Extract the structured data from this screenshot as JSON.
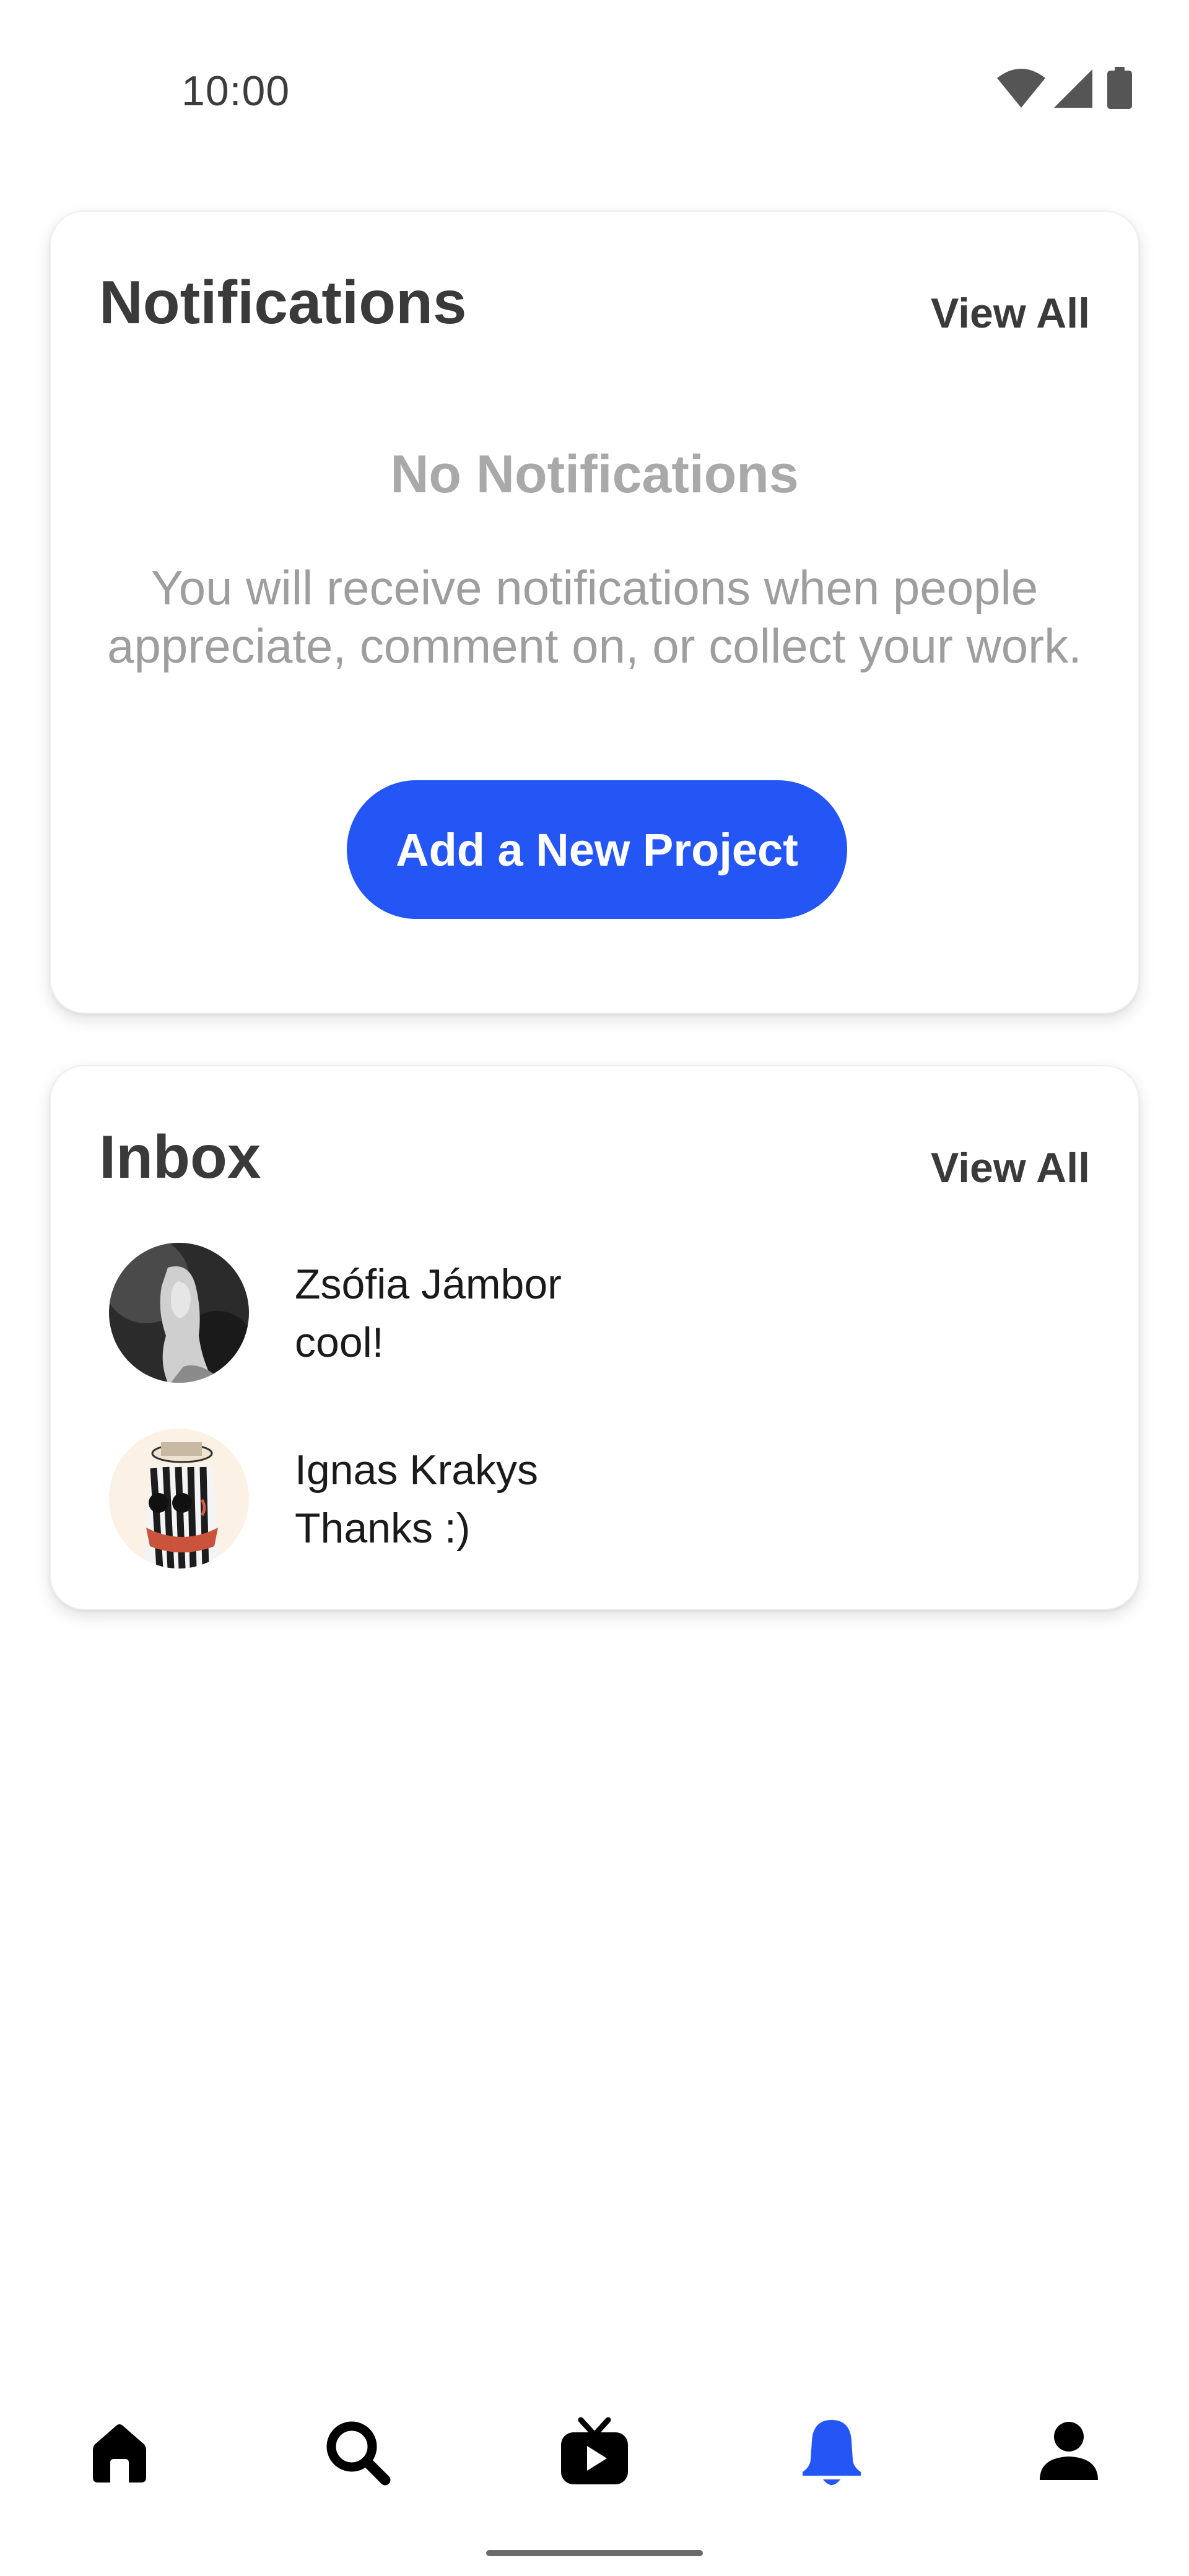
{
  "status_bar": {
    "time": "10:00",
    "icons": [
      "wifi-icon",
      "cellular-signal-icon",
      "battery-icon"
    ]
  },
  "notifications_card": {
    "title": "Notifications",
    "view_all_label": "View All",
    "empty_title": "No Notifications",
    "empty_description": "You will receive notifications when people appreciate, comment on, or collect your work.",
    "add_project_label": "Add a New Project"
  },
  "inbox_card": {
    "title": "Inbox",
    "view_all_label": "View All",
    "messages": [
      {
        "name": "Zsófia Jámbor",
        "text": "cool!"
      },
      {
        "name": "Ignas Krakys",
        "text": "Thanks :)"
      }
    ]
  },
  "bottom_nav": {
    "items": [
      {
        "icon": "home-icon",
        "active": false
      },
      {
        "icon": "search-icon",
        "active": false
      },
      {
        "icon": "video-tv-icon",
        "active": false
      },
      {
        "icon": "bell-icon",
        "active": true
      },
      {
        "icon": "profile-icon",
        "active": false
      }
    ]
  },
  "colors": {
    "accent": "#2456f5",
    "title_text": "#3a3a3a",
    "muted_text": "#a9a9a9",
    "icon_default": "#000000"
  }
}
